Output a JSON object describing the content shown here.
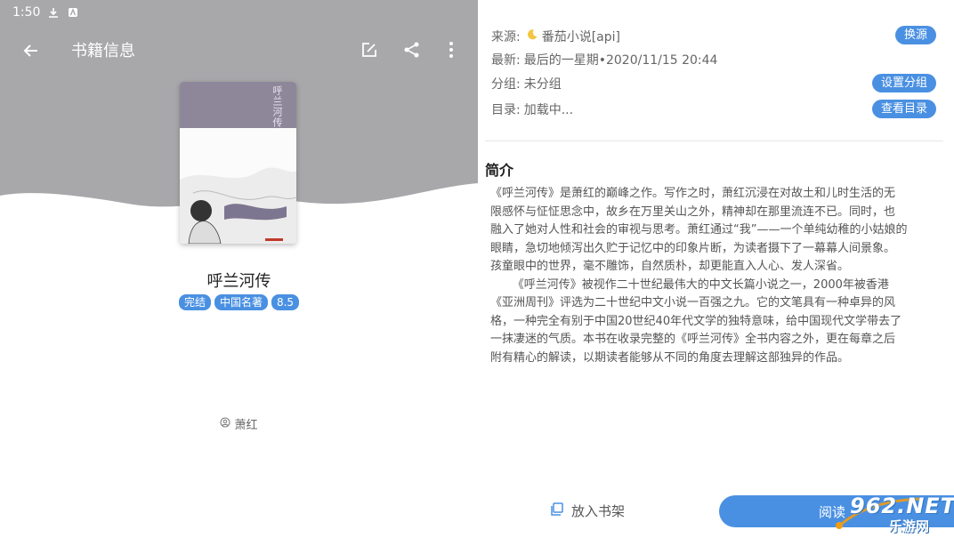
{
  "status_bar": {
    "time": "1:50"
  },
  "toolbar": {
    "title": "书籍信息"
  },
  "book": {
    "title": "呼兰河传",
    "tags": [
      "完结",
      "中国名著",
      "8.5"
    ],
    "author": "萧红",
    "cover_text": "呼兰河传"
  },
  "info": {
    "source_label": "来源:",
    "source_value": "番茄小说[api]",
    "source_button": "换源",
    "latest_label": "最新:",
    "latest_value": "最后的一星期•2020/11/15 20:44",
    "group_label": "分组:",
    "group_value": "未分组",
    "group_button": "设置分组",
    "toc_label": "目录:",
    "toc_value": "加载中...",
    "toc_button": "查看目录"
  },
  "intro": {
    "title": "简介",
    "lines": [
      "《呼兰河传》是萧红的巅峰之作。写作之时，萧红沉浸在对故土和儿时生活的无",
      "限感怀与怔怔思念中，故乡在万里关山之外，精神却在那里流连不已。同时，也",
      "融入了她对人性和社会的审视与思考。萧红通过“我”——一个单纯幼稚的小姑娘的",
      "眼睛，急切地倾泻出久贮于记忆中的印象片断，为读者摄下了一幕幕人间景象。",
      "孩童眼中的世界，毫不雕饰，自然质朴，却更能直入人心、发人深省。",
      "      《呼兰河传》被视作二十世纪最伟大的中文长篇小说之一，2000年被香港",
      "《亚洲周刊》评选为二十世纪中文小说一百强之九。它的文笔具有一种卓异的风",
      "格，一种完全有别于中国20世纪40年代文学的独特意味，给中国现代文学带去了",
      "一抹凄迷的气质。本书在收录完整的《呼兰河传》全书内容之外，更在每章之后",
      "附有精心的解读，以期读者能够从不同的角度去理解这部独异的作品。"
    ]
  },
  "bottom": {
    "add_shelf": "放入书架",
    "read": "阅读"
  },
  "watermark": {
    "line1": "962.NET",
    "line2": "乐游网"
  },
  "colors": {
    "accent": "#4a90e2",
    "header_gray": "#a8a8ab"
  }
}
